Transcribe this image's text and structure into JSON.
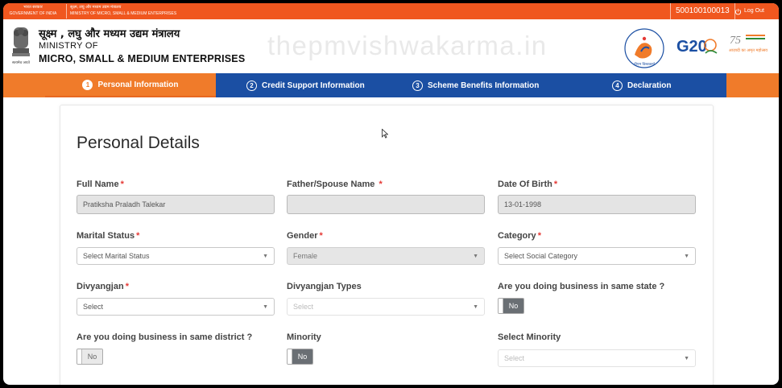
{
  "topbar": {
    "gov_hindi": "भारत सरकार",
    "gov_english": "GOVERNMENT OF INDIA",
    "ministry_hindi": "सूक्ष्म, लघु और मध्यम उद्यम मंत्रालय",
    "ministry_english": "MINISTRY OF MICRO, SMALL & MEDIUM ENTERPRISES",
    "user_id": "500100100013",
    "logout_label": "Log Out"
  },
  "header": {
    "hindi_title": "सूक्ष्म , लघु और मध्यम उद्यम मंत्रालय",
    "ministry_of": "MINISTRY OF",
    "ministry_name": "MICRO, SMALL & MEDIUM ENTERPRISES",
    "emblem_caption": "सत्यमेव जयते",
    "watermark": "thepmvishwakarma.in",
    "vishwakarma_logo_text": "पीएम विश्वकर्मा",
    "g20_text": "G20",
    "azadi_text": "आज़ादी का अमृत महोत्सव"
  },
  "steps": [
    {
      "num": "1",
      "label": "Personal Information"
    },
    {
      "num": "2",
      "label": "Credit Support Information"
    },
    {
      "num": "3",
      "label": "Scheme Benefits Information"
    },
    {
      "num": "4",
      "label": "Declaration"
    }
  ],
  "form": {
    "title": "Personal Details",
    "full_name_label": "Full Name",
    "full_name_value": "Pratiksha Praladh Talekar",
    "father_label": "Father/Spouse Name",
    "father_value": "",
    "dob_label": "Date Of Birth",
    "dob_value": "13-01-1998",
    "marital_label": "Marital Status",
    "marital_value": "Select Marital Status",
    "gender_label": "Gender",
    "gender_value": "Female",
    "category_label": "Category",
    "category_value": "Select Social Category",
    "divyangjan_label": "Divyangjan",
    "divyangjan_value": "Select",
    "divyangjan_types_label": "Divyangjan Types",
    "divyangjan_types_value": "Select",
    "same_state_label": "Are you doing business in same state ?",
    "same_state_value": "No",
    "same_district_label": "Are you doing business in same district ?",
    "same_district_value": "No",
    "minority_label": "Minority",
    "minority_value": "No",
    "select_minority_label": "Select Minority",
    "select_minority_value": "Select",
    "required_mark": "*"
  },
  "colors": {
    "orange": "#f0571f",
    "step_orange": "#f07b2a",
    "blue": "#1b4fa3",
    "required": "#e53935"
  }
}
